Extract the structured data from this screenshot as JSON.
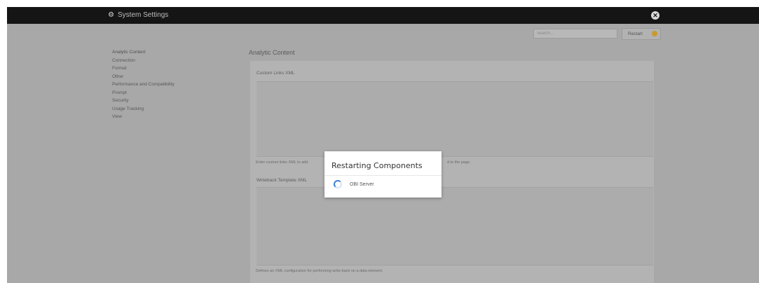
{
  "header": {
    "app_title": "System Settings",
    "app_icon": "settings-gears-icon",
    "close_icon": "close-icon"
  },
  "toolbar": {
    "search_placeholder": "Search...",
    "restart_label": "Restart",
    "restart_status_color": "#c79b2e"
  },
  "sidebar": {
    "items": [
      {
        "label": "Analytic Content",
        "active": true
      },
      {
        "label": "Connection",
        "active": false
      },
      {
        "label": "Format",
        "active": false
      },
      {
        "label": "Other",
        "active": false
      },
      {
        "label": "Performance and Compatibility",
        "active": false
      },
      {
        "label": "Prompt",
        "active": false
      },
      {
        "label": "Security",
        "active": false
      },
      {
        "label": "Usage Tracking",
        "active": false
      },
      {
        "label": "View",
        "active": false
      }
    ]
  },
  "main": {
    "section_title": "Analytic Content",
    "fields": [
      {
        "label": "Custom Links XML",
        "note": "Enter custom links XML to add",
        "note_tail": "d to the page."
      },
      {
        "label": "Writeback Template XML",
        "note": "Defines an XML configuration for performing write-back on a data element."
      }
    ]
  },
  "modal": {
    "title": "Restarting Components",
    "items": [
      {
        "label": "OBI Server",
        "status_icon": "loading-spinner-icon"
      }
    ]
  }
}
